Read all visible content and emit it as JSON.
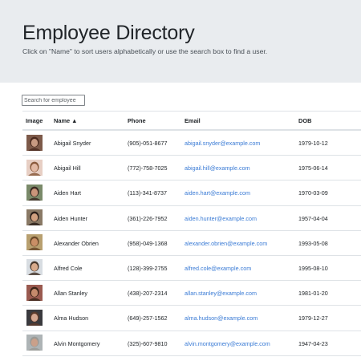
{
  "header": {
    "title": "Employee Directory",
    "subtitle": "Click on \"Name\" to sort users alphabetically or use the search box to find a user."
  },
  "search": {
    "placeholder": "Search for employee",
    "value": ""
  },
  "table": {
    "columns": [
      "Image",
      "Name",
      "Phone",
      "Email",
      "DOB"
    ],
    "sort_indicator": "▲",
    "rows": [
      {
        "name": "Abigail Snyder",
        "phone": "(905)-051-8677",
        "email": "abigail.snyder@example.com",
        "dob": "1979-10-12",
        "skin": "#c79a82",
        "hair": "#4a2a1e",
        "bg": "#7d5a4a"
      },
      {
        "name": "Abigail Hill",
        "phone": "(772)-758-7025",
        "email": "abigail.hill@example.com",
        "dob": "1975-06-14",
        "skin": "#e2b9a4",
        "hair": "#8a5a3c",
        "bg": "#e7cfc4"
      },
      {
        "name": "Aiden Hart",
        "phone": "(113)-341-8737",
        "email": "aiden.hart@example.com",
        "dob": "1970-03-09",
        "skin": "#c9957a",
        "hair": "#3a2a22",
        "bg": "#7a8a6a"
      },
      {
        "name": "Aiden Hunter",
        "phone": "(361)-226-7952",
        "email": "aiden.hunter@example.com",
        "dob": "1957-04-04",
        "skin": "#d0a080",
        "hair": "#2c201a",
        "bg": "#8a7a66"
      },
      {
        "name": "Alexander Obrien",
        "phone": "(958)-049-1368",
        "email": "alexander.obrien@example.com",
        "dob": "1993-05-08",
        "skin": "#c98f66",
        "hair": "#6a4a2a",
        "bg": "#b8a070"
      },
      {
        "name": "Alfred Cole",
        "phone": "(128)-399-2755",
        "email": "alfred.cole@example.com",
        "dob": "1995-08-10",
        "skin": "#d8ab8c",
        "hair": "#4a3a2e",
        "bg": "#d8dde2"
      },
      {
        "name": "Allan Stanley",
        "phone": "(438)-207-2314",
        "email": "allan.stanley@example.com",
        "dob": "1981-01-20",
        "skin": "#c58a6c",
        "hair": "#3a2418",
        "bg": "#9a5a50"
      },
      {
        "name": "Alma Hudson",
        "phone": "(649)-257-1562",
        "email": "alma.hudson@example.com",
        "dob": "1979-12-27",
        "skin": "#d4a690",
        "hair": "#5a3a2c",
        "bg": "#3a3a3e"
      },
      {
        "name": "Alvin Montgomery",
        "phone": "(325)-607-9810",
        "email": "alvin.montgomery@example.com",
        "dob": "1947-04-23",
        "skin": "#caa08a",
        "hair": "#9a9a96",
        "bg": "#aeb4b6"
      }
    ]
  }
}
